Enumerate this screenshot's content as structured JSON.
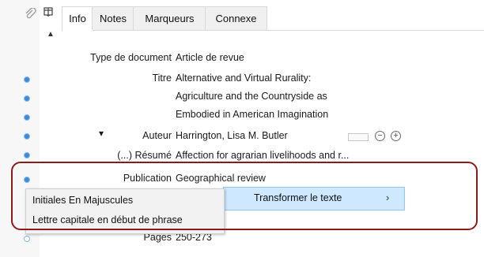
{
  "tabs": [
    {
      "label": "Info",
      "active": true
    },
    {
      "label": "Notes",
      "active": false
    },
    {
      "label": "Marqueurs",
      "active": false
    },
    {
      "label": "Connexe",
      "active": false
    }
  ],
  "fields": {
    "item_type_label": "Type de document",
    "item_type_value": "Article de revue",
    "title_label": "Titre",
    "title_lines": [
      "Alternative and Virtual Rurality:",
      "Agriculture and the Countryside as",
      "Embodied in American Imagination"
    ],
    "author_toggle": "▾",
    "author_label": "Auteur",
    "author_value": "Harrington, Lisa M. Butler",
    "abstract_label": "(...) Résumé",
    "abstract_value": "Affection for agrarian livelihoods and r...",
    "publication_label": "Publication",
    "publication_value": "Geographical review",
    "pages_label": "Pages",
    "pages_value": "250-273"
  },
  "context_menu": {
    "item_label": "Transformer le texte",
    "item_arrow": "›",
    "submenu": [
      "Initiales En Majuscules",
      "Lettre capitale en début de phrase"
    ]
  },
  "icons": {
    "attachment": "paperclip-icon",
    "columns": "column-picker-icon",
    "scroll_up": "▲",
    "remove_creator": "−",
    "add_creator": "+"
  },
  "colors": {
    "menu_highlight": "#cde8ff",
    "annotation_outline": "#8b1a1a",
    "gutter_dot": "#3a8dde"
  }
}
